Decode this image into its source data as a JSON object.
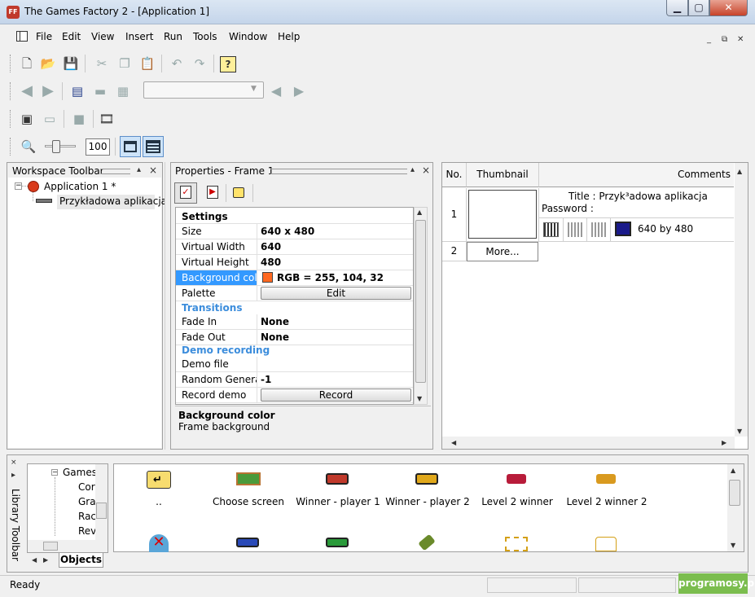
{
  "window": {
    "title": "The Games Factory 2 - [Application 1]",
    "app_icon_text": "FF",
    "min": "▁",
    "max": "▢",
    "close": "✕"
  },
  "menu": {
    "items": [
      "File",
      "Edit",
      "View",
      "Insert",
      "Run",
      "Tools",
      "Window",
      "Help"
    ],
    "mdi_min": "_",
    "mdi_restore": "⧉",
    "mdi_close": "✕"
  },
  "toolbar": {
    "zoom_value": "100"
  },
  "workspace": {
    "title": "Workspace Toolbar",
    "app_node": "Application 1 *",
    "frame_node": "Przykładowa aplikacja",
    "expand_glyph": "−"
  },
  "properties": {
    "title": "Properties - Frame 1",
    "sections": {
      "settings": "Settings",
      "transitions": "Transitions",
      "demo": "Demo recording"
    },
    "rows": {
      "size_k": "Size",
      "size_v": "640 x 480",
      "vw_k": "Virtual Width",
      "vw_v": "640",
      "vh_k": "Virtual Height",
      "vh_v": "480",
      "bg_k": "Background color",
      "bg_v": "RGB = 255, 104, 32",
      "pal_k": "Palette",
      "pal_btn": "Edit",
      "fin_k": "Fade In",
      "fin_v": "None",
      "fout_k": "Fade Out",
      "fout_v": "None",
      "demo_k": "Demo file",
      "demo_v": "",
      "rnd_k": "Random Generator",
      "rnd_v": "-1",
      "rec_k": "Record demo",
      "rec_btn": "Record"
    },
    "desc_title": "Background color",
    "desc_text": "Frame background",
    "bg_swatch": "#ff6820"
  },
  "framelist": {
    "headers": [
      "No.",
      "Thumbnail",
      "Comments"
    ],
    "row1_no": "1",
    "row1_title": "Title : Przyk³adowa aplikacja",
    "row1_password": "Password :",
    "row1_size": "640  by  480",
    "row2_no": "2",
    "row2_more": "More..."
  },
  "library": {
    "side_label": "Library Toolbar",
    "tree_root": "Games",
    "tree_items": [
      "Cor",
      "Gra",
      "Rac",
      "Rev"
    ],
    "tab": "Objects",
    "objects": [
      "..",
      "Choose screen",
      "Winner - player 1",
      "Winner - player 2",
      "Level 2 winner",
      "Level 2 winner 2"
    ]
  },
  "status": {
    "text": "Ready",
    "watermark": "programosy.pl"
  },
  "colors": {
    "accent_blue": "#3c8ddc",
    "selection": "#3399ff",
    "title_grad": "#c4d5ea"
  }
}
